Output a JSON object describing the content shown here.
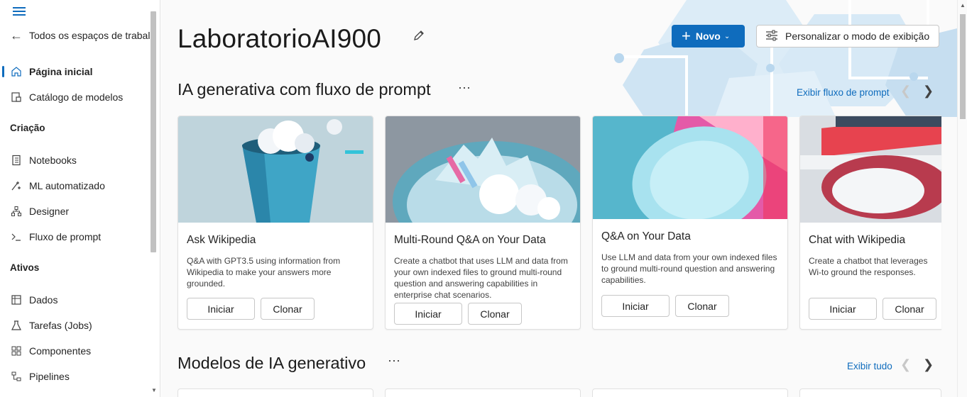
{
  "sidebar": {
    "back_label": "Todos os espaços de trabal",
    "items_top": [
      {
        "label": "Página inicial",
        "icon": "home-icon",
        "active": true
      },
      {
        "label": "Catálogo de modelos",
        "icon": "catalog-icon"
      }
    ],
    "section_creation": "Criação",
    "items_creation": [
      {
        "label": "Notebooks",
        "icon": "notebook-icon"
      },
      {
        "label": "ML automatizado",
        "icon": "automl-icon"
      },
      {
        "label": "Designer",
        "icon": "designer-icon"
      },
      {
        "label": "Fluxo de prompt",
        "icon": "prompt-flow-icon"
      }
    ],
    "section_assets": "Ativos",
    "items_assets": [
      {
        "label": "Dados",
        "icon": "data-icon"
      },
      {
        "label": "Tarefas (Jobs)",
        "icon": "jobs-icon"
      },
      {
        "label": "Componentes",
        "icon": "components-icon"
      },
      {
        "label": "Pipelines",
        "icon": "pipelines-icon"
      }
    ]
  },
  "header": {
    "title": "LaboratorioAI900",
    "new_label": "Novo",
    "customize_label": "Personalizar o modo de exibição"
  },
  "section1": {
    "title": "IA generativa com fluxo de prompt",
    "link": "Exibir fluxo de prompt",
    "cards": [
      {
        "title": "Ask Wikipedia",
        "desc": "Q&A with GPT3.5 using information from Wikipedia to make your answers more grounded.",
        "start": "Iniciar",
        "clone": "Clonar"
      },
      {
        "title": "Multi-Round Q&A on Your Data",
        "desc": "Create a chatbot that uses LLM and data from your own indexed files to ground multi-round question and answering capabilities in enterprise chat scenarios.",
        "start": "Iniciar",
        "clone": "Clonar"
      },
      {
        "title": "Q&A on Your Data",
        "desc": "Use LLM and data from your own indexed files to ground multi-round question and answering capabilities.",
        "start": "Iniciar",
        "clone": "Clonar"
      },
      {
        "title": "Chat with Wikipedia",
        "desc": "Create a chatbot that leverages Wi-to ground the responses.",
        "start": "Iniciar",
        "clone": "Clonar"
      }
    ]
  },
  "section2": {
    "title": "Modelos de IA generativo",
    "link": "Exibir tudo"
  },
  "colors": {
    "accent": "#0f6cbd",
    "background": "#fafafa"
  }
}
